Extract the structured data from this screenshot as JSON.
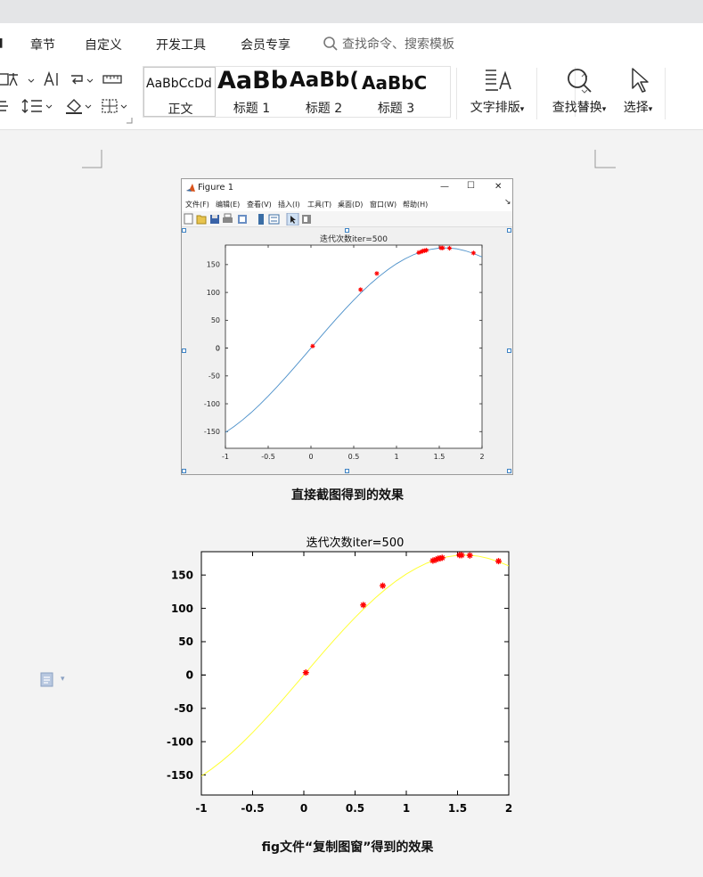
{
  "ribbon": {
    "tabs": [
      "章节",
      "自定义",
      "开发工具",
      "会员专享"
    ],
    "search_placeholder": "查找命令、搜索模板",
    "styles": [
      {
        "sample": "AaBbCcDd",
        "name": "正文"
      },
      {
        "sample": "AaBb",
        "name": "标题 1"
      },
      {
        "sample": "AaBb(",
        "name": "标题 2"
      },
      {
        "sample": "AaBbC",
        "name": "标题 3"
      }
    ],
    "text_layout_label": "文字排版",
    "find_replace_label": "查找替换",
    "select_label": "选择"
  },
  "figure_window": {
    "title": "Figure 1",
    "menu": [
      "文件(F)",
      "编辑(E)",
      "查看(V)",
      "插入(I)",
      "工具(T)",
      "桌面(D)",
      "窗口(W)",
      "帮助(H)"
    ],
    "controls": [
      "—",
      "☐",
      "✕"
    ]
  },
  "captions": {
    "screenshot": "直接截图得到的效果",
    "copy_figure": "fig文件“复制图窗”得到的效果"
  },
  "colors": {
    "plot1_line": "#4a8fc9",
    "plot2_line": "#ffff33",
    "marker": "#ff0000",
    "selection_handle": "#3c82c4"
  },
  "chart_data": [
    {
      "type": "scatter",
      "title": "迭代次数iter=500",
      "xlim": [
        -1,
        2
      ],
      "ylim": [
        -180,
        185
      ],
      "xticks": [
        "-1",
        "-0.5",
        "0",
        "0.5",
        "1",
        "1.5",
        "2"
      ],
      "yticks": [
        "-150",
        "-100",
        "-50",
        "0",
        "50",
        "100",
        "150"
      ],
      "curve": "y = 180*sin(x)",
      "series": [
        {
          "type": "line",
          "x": [
            -1,
            -0.9,
            -0.8,
            -0.7,
            -0.6,
            -0.5,
            -0.4,
            -0.3,
            -0.2,
            -0.1,
            0,
            0.1,
            0.2,
            0.3,
            0.4,
            0.5,
            0.6,
            0.7,
            0.8,
            0.9,
            1,
            1.1,
            1.2,
            1.3,
            1.4,
            1.5,
            1.6,
            1.7,
            1.8,
            1.9,
            2
          ],
          "y": [
            -151.5,
            -141.0,
            -129.1,
            -116.0,
            -101.6,
            -86.3,
            -70.1,
            -53.2,
            -35.8,
            -18.0,
            0,
            18.0,
            35.8,
            53.2,
            70.1,
            86.3,
            101.6,
            116.0,
            129.1,
            141.0,
            151.5,
            160.4,
            167.8,
            173.4,
            177.3,
            179.6,
            179.9,
            178.4,
            175.0,
            170.0,
            163.7
          ]
        },
        {
          "type": "markers",
          "x": [
            0.02,
            0.58,
            0.77,
            1.26,
            1.29,
            1.31,
            1.33,
            1.35,
            1.52,
            1.54,
            1.62,
            1.9
          ],
          "y": [
            3.6,
            105,
            134,
            171.6,
            173,
            174.6,
            175,
            175.8,
            179.9,
            179.8,
            179.4,
            170.8
          ]
        }
      ]
    },
    {
      "type": "scatter",
      "title": "迭代次数iter=500",
      "xlim": [
        -1,
        2
      ],
      "ylim": [
        -180,
        185
      ],
      "xticks": [
        "-1",
        "-0.5",
        "0",
        "0.5",
        "1",
        "1.5",
        "2"
      ],
      "yticks": [
        "-150",
        "-100",
        "-50",
        "0",
        "50",
        "100",
        "150"
      ],
      "curve": "y = 180*sin(x)",
      "series": [
        {
          "type": "line",
          "x": [
            -1,
            -0.9,
            -0.8,
            -0.7,
            -0.6,
            -0.5,
            -0.4,
            -0.3,
            -0.2,
            -0.1,
            0,
            0.1,
            0.2,
            0.3,
            0.4,
            0.5,
            0.6,
            0.7,
            0.8,
            0.9,
            1,
            1.1,
            1.2,
            1.3,
            1.4,
            1.5,
            1.6,
            1.7,
            1.8,
            1.9,
            2
          ],
          "y": [
            -151.5,
            -141.0,
            -129.1,
            -116.0,
            -101.6,
            -86.3,
            -70.1,
            -53.2,
            -35.8,
            -18.0,
            0,
            18.0,
            35.8,
            53.2,
            70.1,
            86.3,
            101.6,
            116.0,
            129.1,
            141.0,
            151.5,
            160.4,
            167.8,
            173.4,
            177.3,
            179.6,
            179.9,
            178.4,
            175.0,
            170.0,
            163.7
          ]
        },
        {
          "type": "markers",
          "x": [
            0.02,
            0.58,
            0.77,
            1.26,
            1.29,
            1.31,
            1.33,
            1.35,
            1.52,
            1.54,
            1.62,
            1.9
          ],
          "y": [
            3.6,
            105,
            134,
            171.6,
            173,
            174.6,
            175,
            175.8,
            179.9,
            179.8,
            179.4,
            170.8
          ]
        }
      ]
    }
  ]
}
